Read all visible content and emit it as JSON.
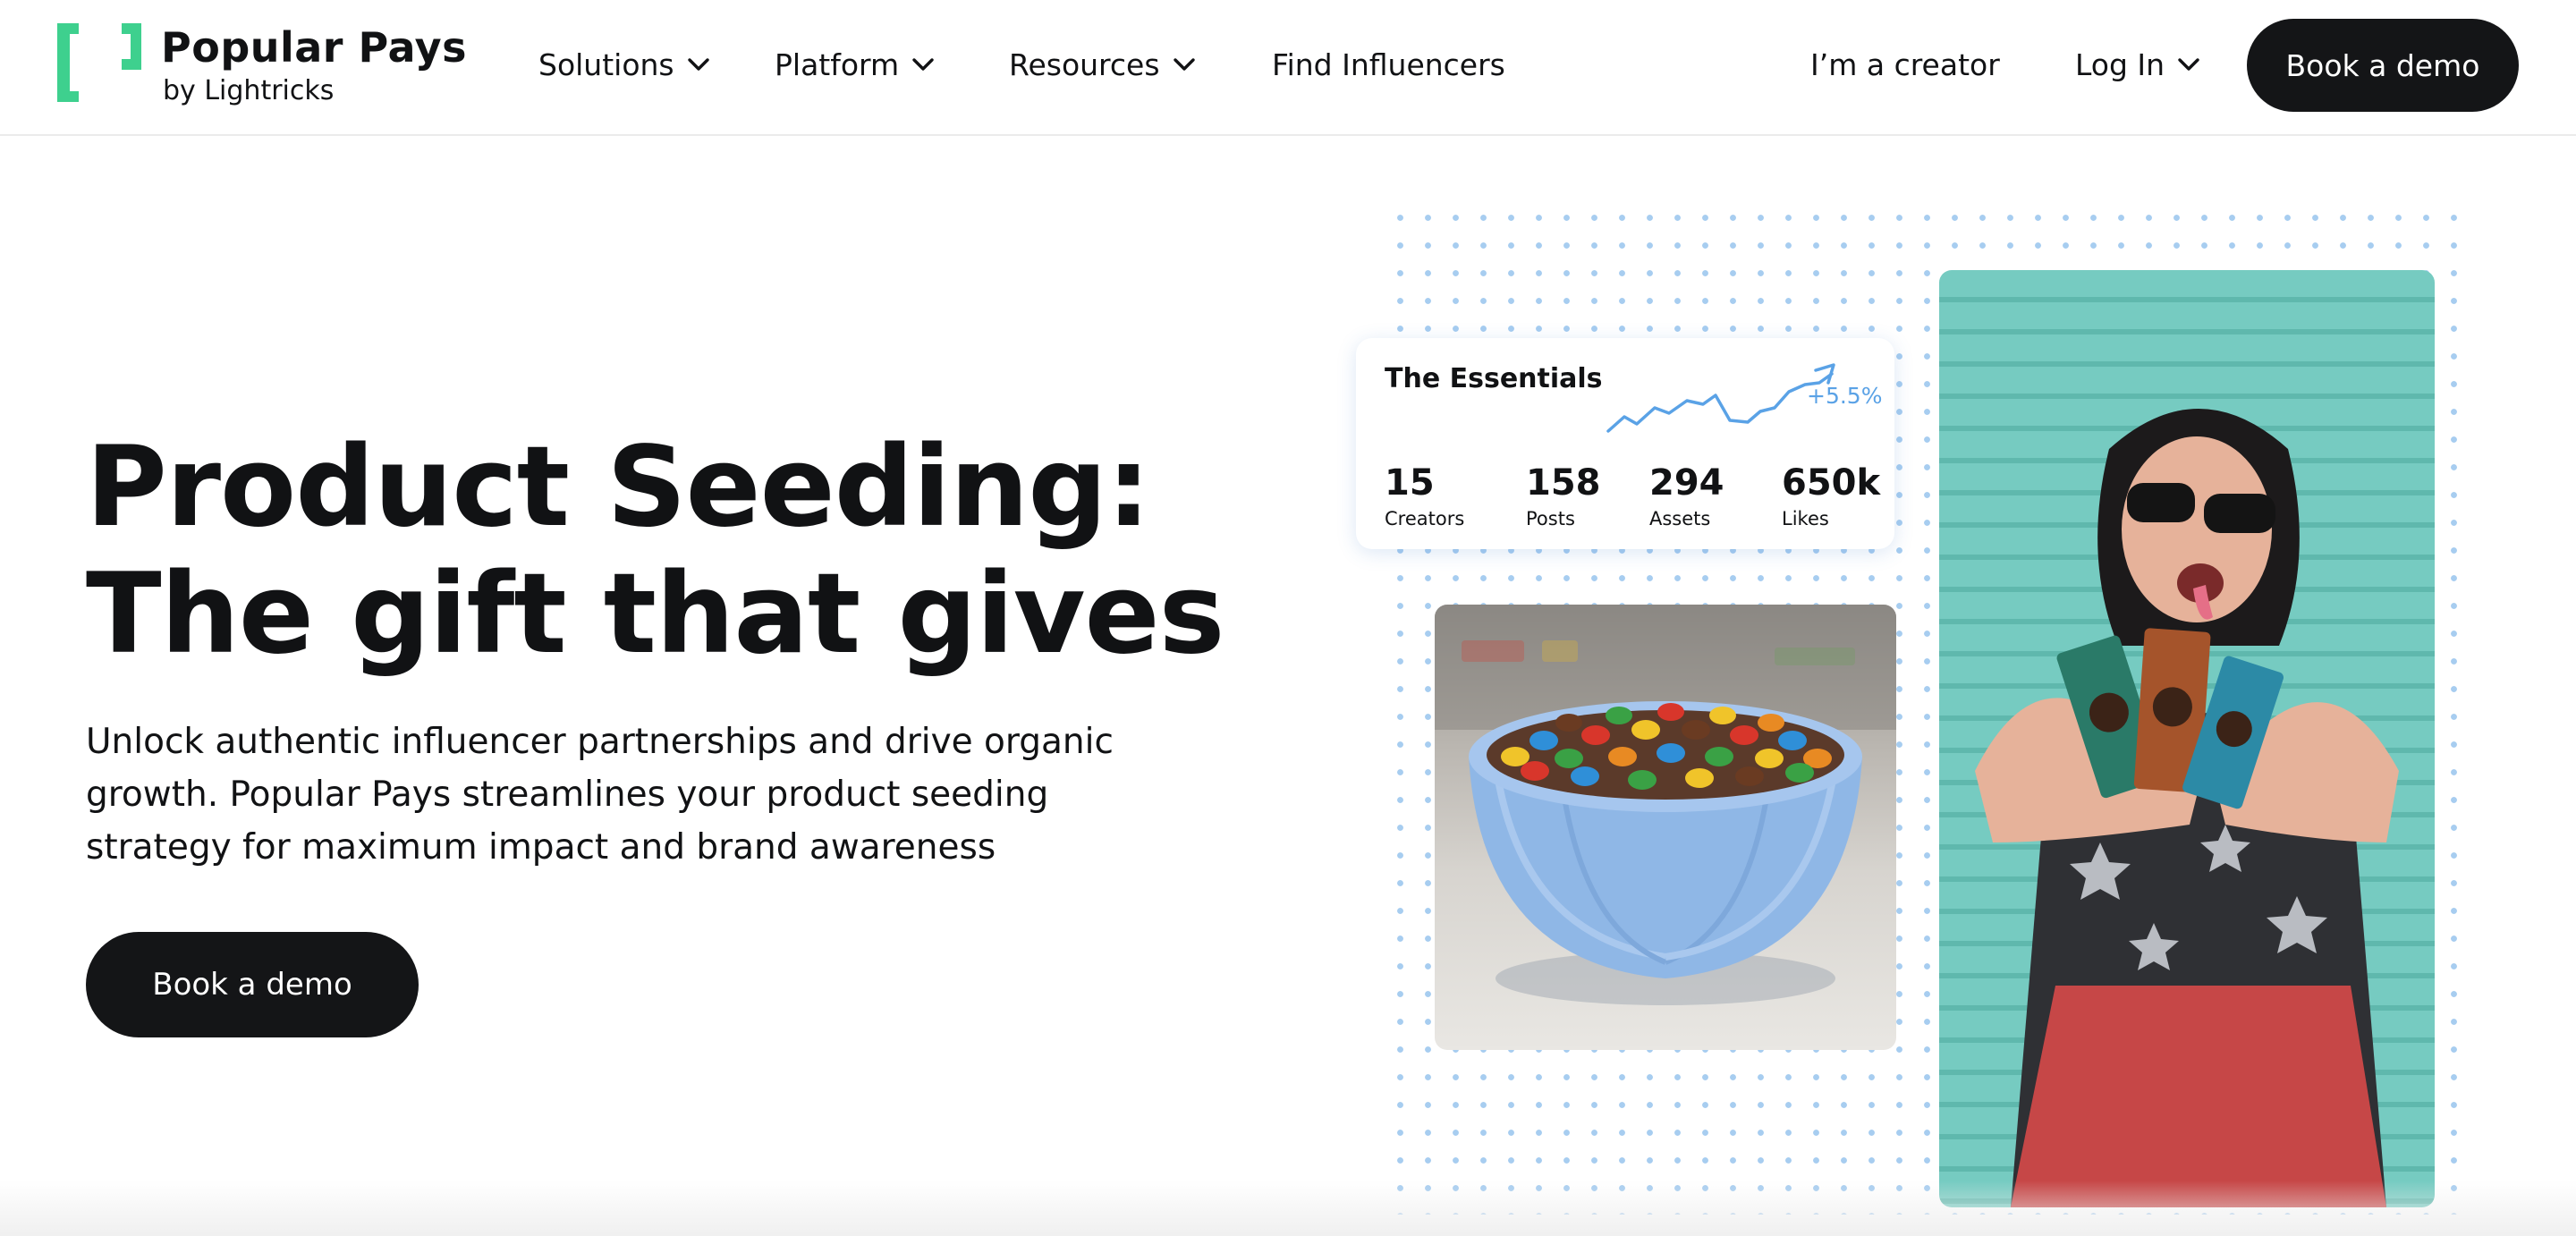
{
  "brand": {
    "name": "Popular Pays",
    "sub": "by Lightricks",
    "accent": "#3ed08e"
  },
  "nav": {
    "items": [
      {
        "label": "Solutions",
        "dropdown": true
      },
      {
        "label": "Platform",
        "dropdown": true
      },
      {
        "label": "Resources",
        "dropdown": true
      },
      {
        "label": "Find Influencers",
        "dropdown": false
      }
    ],
    "creator_link": "I’m a creator",
    "login_label": "Log In",
    "demo_label": "Book a demo"
  },
  "hero": {
    "title": "Product Seeding: The gift that gives",
    "subtitle": "Unlock authentic influencer partnerships and drive organic growth. Popular Pays streamlines your product seeding strategy for maximum impact and brand awareness",
    "cta_label": "Book a demo"
  },
  "stats_card": {
    "title": "The Essentials",
    "delta": "+5.5%",
    "delta_color": "#5aa2e6",
    "stats": [
      {
        "value": "15",
        "label": "Creators"
      },
      {
        "value": "158",
        "label": "Posts"
      },
      {
        "value": "294",
        "label": "Assets"
      },
      {
        "value": "650k",
        "label": "Likes"
      }
    ]
  },
  "images": {
    "bowl": "bowl-of-candy-photo",
    "creator": "creator-holding-candy-photo"
  },
  "colors": {
    "button_bg": "#141517",
    "dot_grid": "#a7cdf0",
    "teal_wall": "#6fc7bd"
  }
}
